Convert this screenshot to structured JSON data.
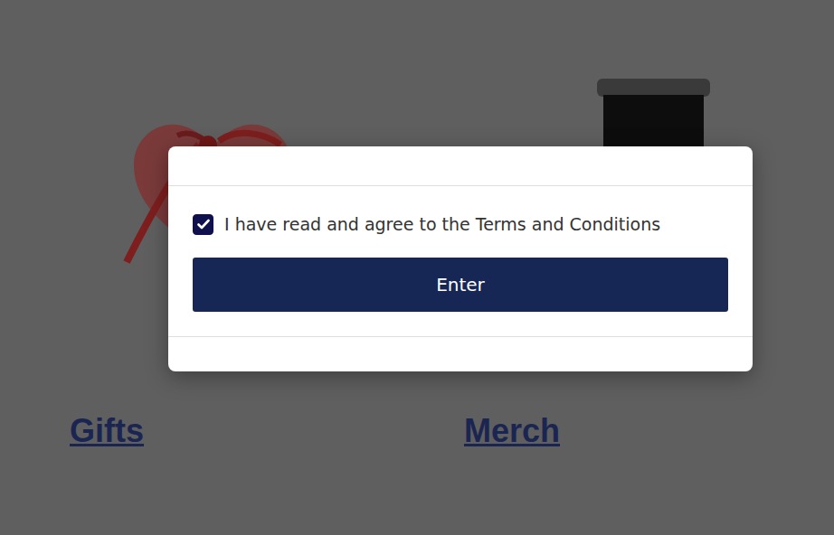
{
  "categories": [
    {
      "label": "Gifts"
    },
    {
      "label": "Merch"
    }
  ],
  "modal": {
    "agree": {
      "label": "I have read and agree to the Terms and Conditions",
      "checked": true
    },
    "button": "Enter"
  }
}
